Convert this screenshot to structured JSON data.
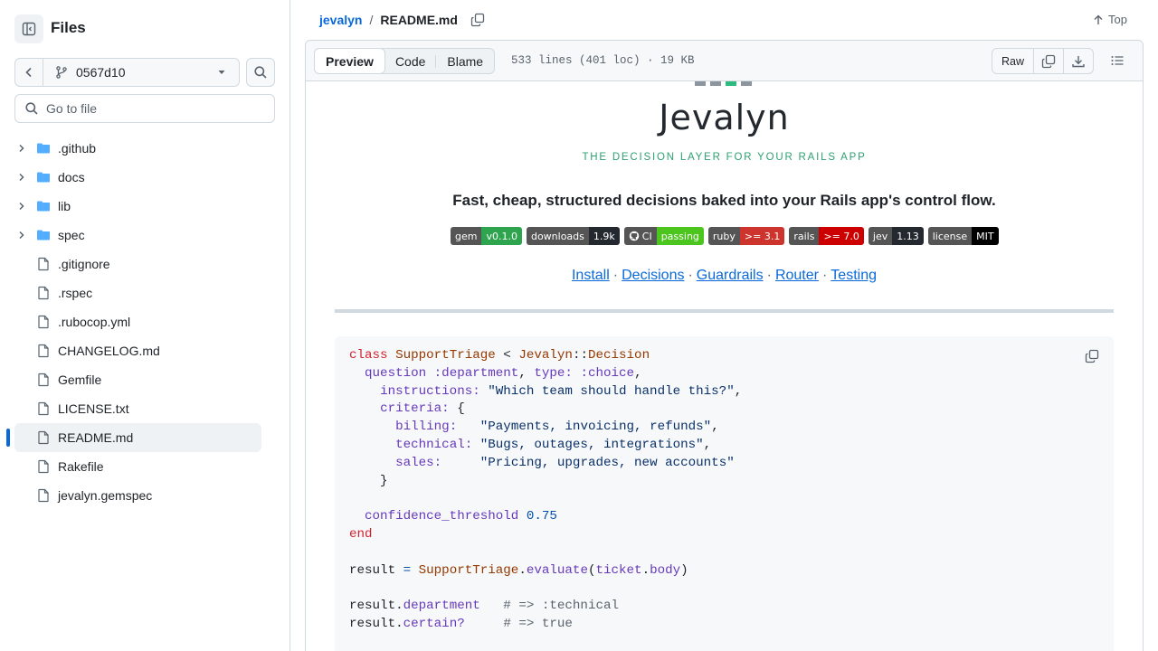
{
  "sidebar": {
    "title": "Files",
    "branch": "0567d10",
    "goto_placeholder": "Go to file",
    "items": [
      {
        "type": "dir",
        "label": ".github"
      },
      {
        "type": "dir",
        "label": "docs"
      },
      {
        "type": "dir",
        "label": "lib"
      },
      {
        "type": "dir",
        "label": "spec"
      },
      {
        "type": "file",
        "label": ".gitignore"
      },
      {
        "type": "file",
        "label": ".rspec"
      },
      {
        "type": "file",
        "label": ".rubocop.yml"
      },
      {
        "type": "file",
        "label": "CHANGELOG.md"
      },
      {
        "type": "file",
        "label": "Gemfile"
      },
      {
        "type": "file",
        "label": "LICENSE.txt"
      },
      {
        "type": "file",
        "label": "README.md",
        "active": true
      },
      {
        "type": "file",
        "label": "Rakefile"
      },
      {
        "type": "file",
        "label": "jevalyn.gemspec"
      }
    ]
  },
  "breadcrumb": {
    "repo": "jevalyn",
    "separator": "/",
    "file": "README.md"
  },
  "top_label": "Top",
  "file_bar": {
    "tabs": [
      "Preview",
      "Code",
      "Blame"
    ],
    "active_tab": "Preview",
    "meta": "533 lines (401 loc) · 19 KB",
    "raw_label": "Raw"
  },
  "readme": {
    "logo_word": "Jevalyn",
    "tagline": "THE DECISION LAYER FOR YOUR RAILS APP",
    "lead": "Fast, cheap, structured decisions baked into your Rails app's control flow.",
    "badges": [
      {
        "key": "gem",
        "value": "v0.1.0",
        "color": "#2ea44f"
      },
      {
        "key": "downloads",
        "value": "1.9k",
        "color": "#24292f"
      },
      {
        "key": "CI",
        "value": "passing",
        "color": "#4cc61e",
        "icon": "github-icon"
      },
      {
        "key": "ruby",
        "value": ">= 3.1",
        "color": "#cc342d"
      },
      {
        "key": "rails",
        "value": ">= 7.0",
        "color": "#cc0000"
      },
      {
        "key": "jev",
        "value": "1.13",
        "color": "#24292f"
      },
      {
        "key": "license",
        "value": "MIT",
        "color": "#000000"
      }
    ],
    "links": [
      "Install",
      "Decisions",
      "Guardrails",
      "Router",
      "Testing"
    ],
    "code_lines": [
      [
        [
          "kw",
          "class"
        ],
        [
          "p",
          " "
        ],
        [
          "cls",
          "SupportTriage"
        ],
        [
          "p",
          " < "
        ],
        [
          "cls",
          "Jevalyn"
        ],
        [
          "p",
          "::"
        ],
        [
          "cls",
          "Decision"
        ]
      ],
      [
        [
          "p",
          "  "
        ],
        [
          "sym",
          "question"
        ],
        [
          "p",
          " "
        ],
        [
          "sym",
          ":department"
        ],
        [
          "p",
          ", "
        ],
        [
          "sym",
          "type:"
        ],
        [
          "p",
          " "
        ],
        [
          "sym",
          ":choice"
        ],
        [
          "p",
          ","
        ]
      ],
      [
        [
          "p",
          "    "
        ],
        [
          "sym",
          "instructions:"
        ],
        [
          "p",
          " "
        ],
        [
          "str",
          "\"Which team should handle this?\""
        ],
        [
          "p",
          ","
        ]
      ],
      [
        [
          "p",
          "    "
        ],
        [
          "sym",
          "criteria:"
        ],
        [
          "p",
          " {"
        ]
      ],
      [
        [
          "p",
          "      "
        ],
        [
          "sym",
          "billing:"
        ],
        [
          "p",
          "   "
        ],
        [
          "str",
          "\"Payments, invoicing, refunds\""
        ],
        [
          "p",
          ","
        ]
      ],
      [
        [
          "p",
          "      "
        ],
        [
          "sym",
          "technical:"
        ],
        [
          "p",
          " "
        ],
        [
          "str",
          "\"Bugs, outages, integrations\""
        ],
        [
          "p",
          ","
        ]
      ],
      [
        [
          "p",
          "      "
        ],
        [
          "sym",
          "sales:"
        ],
        [
          "p",
          "     "
        ],
        [
          "str",
          "\"Pricing, upgrades, new accounts\""
        ]
      ],
      [
        [
          "p",
          "    }"
        ]
      ],
      [
        [
          "p",
          ""
        ]
      ],
      [
        [
          "p",
          "  "
        ],
        [
          "sym",
          "confidence_threshold"
        ],
        [
          "p",
          " "
        ],
        [
          "num",
          "0.75"
        ]
      ],
      [
        [
          "kw",
          "end"
        ]
      ],
      [
        [
          "p",
          ""
        ]
      ],
      [
        [
          "p",
          "result "
        ],
        [
          "op",
          "="
        ],
        [
          "p",
          " "
        ],
        [
          "cls",
          "SupportTriage"
        ],
        [
          "p",
          "."
        ],
        [
          "sym",
          "evaluate"
        ],
        [
          "p",
          "("
        ],
        [
          "sym",
          "ticket"
        ],
        [
          "p",
          "."
        ],
        [
          "sym",
          "body"
        ],
        [
          "p",
          ")"
        ]
      ],
      [
        [
          "p",
          ""
        ]
      ],
      [
        [
          "p",
          "result."
        ],
        [
          "sym",
          "department"
        ],
        [
          "p",
          "   "
        ],
        [
          "com",
          "# => :technical"
        ]
      ],
      [
        [
          "p",
          "result."
        ],
        [
          "sym",
          "certain?"
        ],
        [
          "p",
          "     "
        ],
        [
          "com",
          "# => true"
        ]
      ]
    ]
  }
}
